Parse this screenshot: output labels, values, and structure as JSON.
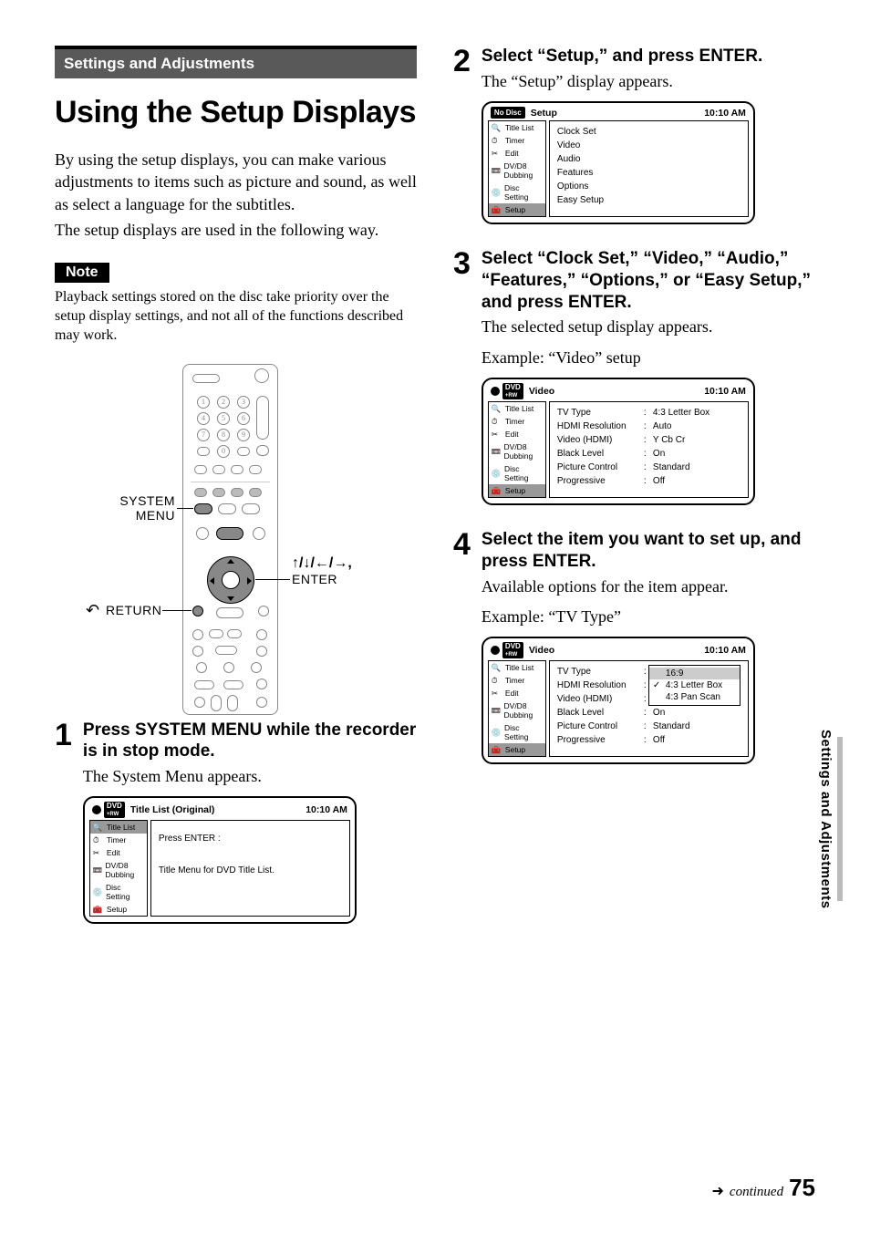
{
  "chapter_band": "Settings and Adjustments",
  "title": "Using the Setup Displays",
  "intro_p1": "By using the setup displays, you can make various adjustments to items such as picture and sound, as well as select a language for the subtitles.",
  "intro_p2": "The setup displays are used in the following way.",
  "note_label": "Note",
  "note_text": "Playback settings stored on the disc take priority over the setup display settings, and not all of the functions described may work.",
  "remote": {
    "label_system_menu_1": "SYSTEM",
    "label_system_menu_2": "MENU",
    "label_return": "RETURN",
    "label_arrows": "↑/↓/←/→,",
    "label_enter": "ENTER"
  },
  "osd_common": {
    "badge_dvd": "DVD",
    "badge_rw": "+RW",
    "badge_nodisc": "No Disc",
    "time": "10:10 AM",
    "sidebar": {
      "title_list": "Title List",
      "timer": "Timer",
      "edit": "Edit",
      "dubbing": "DV/D8 Dubbing",
      "disc_setting": "Disc Setting",
      "setup": "Setup"
    }
  },
  "step1": {
    "num": "1",
    "head": "Press SYSTEM MENU while the recorder is in stop mode.",
    "text": "The System Menu appears.",
    "osd": {
      "title": "Title List (Original)",
      "main_line1": "Press ENTER :",
      "main_line2": "Title Menu for DVD Title List."
    }
  },
  "step2": {
    "num": "2",
    "head": "Select “Setup,” and press ENTER.",
    "text": "The “Setup” display appears.",
    "osd": {
      "title": "Setup",
      "items": [
        "Clock Set",
        "Video",
        "Audio",
        "Features",
        "Options",
        "Easy Setup"
      ]
    }
  },
  "step3": {
    "num": "3",
    "head": "Select “Clock Set,” “Video,” “Audio,” “Features,” “Options,” or “Easy Setup,” and press ENTER.",
    "text1": "The selected setup display appears.",
    "text2": "Example: “Video” setup",
    "osd": {
      "title": "Video",
      "rows": [
        {
          "label": "TV Type",
          "val": "4:3 Letter Box"
        },
        {
          "label": "HDMI Resolution",
          "val": "Auto"
        },
        {
          "label": "Video (HDMI)",
          "val": "Y Cb Cr"
        },
        {
          "label": "Black Level",
          "val": "On"
        },
        {
          "label": "Picture Control",
          "val": "Standard"
        },
        {
          "label": "Progressive",
          "val": "Off"
        }
      ]
    }
  },
  "step4": {
    "num": "4",
    "head": "Select the item you want to set up, and press ENTER.",
    "text1": "Available options for the item appear.",
    "text2": "Example: “TV Type”",
    "osd": {
      "title": "Video",
      "rows": [
        {
          "label": "TV Type"
        },
        {
          "label": "HDMI Resolution"
        },
        {
          "label": "Video (HDMI)"
        },
        {
          "label": "Black Level",
          "val": "On"
        },
        {
          "label": "Picture Control",
          "val": "Standard"
        },
        {
          "label": "Progressive",
          "val": "Off"
        }
      ],
      "dropdown": {
        "items": [
          "16:9",
          "4:3 Letter Box",
          "4:3 Pan Scan"
        ],
        "selected_index": 1,
        "highlight_index": 0
      }
    }
  },
  "side_tab": "Settings and Adjustments",
  "continued": "continued",
  "page_number": "75"
}
